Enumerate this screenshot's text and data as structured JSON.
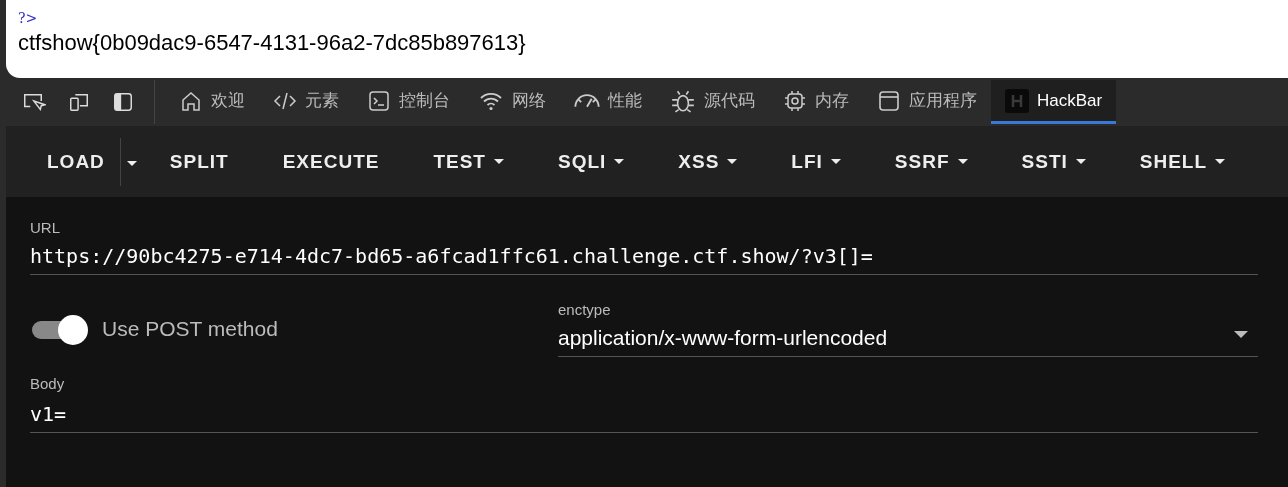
{
  "page_output": {
    "code_line": "?>",
    "flag": "ctfshow{0b09dac9-6547-4131-96a2-7dc85b897613}"
  },
  "devtools_tabs": [
    {
      "kind": "home",
      "label": "欢迎",
      "selected": false
    },
    {
      "kind": "code",
      "label": "元素",
      "selected": false
    },
    {
      "kind": "console",
      "label": "控制台",
      "selected": false
    },
    {
      "kind": "wifi",
      "label": "网络",
      "selected": false
    },
    {
      "kind": "gauge",
      "label": "性能",
      "selected": false
    },
    {
      "kind": "bug",
      "label": "源代码",
      "selected": false
    },
    {
      "kind": "chip",
      "label": "内存",
      "selected": false
    },
    {
      "kind": "window",
      "label": "应用程序",
      "selected": false
    },
    {
      "kind": "hackbar",
      "label": "HackBar",
      "selected": true
    }
  ],
  "hackbar_menu": [
    {
      "label": "LOAD",
      "kind": "split"
    },
    {
      "label": "SPLIT",
      "kind": "plain"
    },
    {
      "label": "EXECUTE",
      "kind": "plain"
    },
    {
      "label": "TEST",
      "kind": "dropdown"
    },
    {
      "label": "SQLI",
      "kind": "dropdown"
    },
    {
      "label": "XSS",
      "kind": "dropdown"
    },
    {
      "label": "LFI",
      "kind": "dropdown"
    },
    {
      "label": "SSRF",
      "kind": "dropdown"
    },
    {
      "label": "SSTI",
      "kind": "dropdown"
    },
    {
      "label": "SHELL",
      "kind": "dropdown"
    }
  ],
  "url_field": {
    "label": "URL",
    "value": "https://90bc4275-e714-4dc7-bd65-a6fcad1ffc61.challenge.ctf.show/?v3[]="
  },
  "post_toggle": {
    "label": "Use POST method",
    "on": true
  },
  "enctype": {
    "label": "enctype",
    "value": "application/x-www-form-urlencoded"
  },
  "body_field": {
    "label": "Body",
    "value": "v1="
  }
}
